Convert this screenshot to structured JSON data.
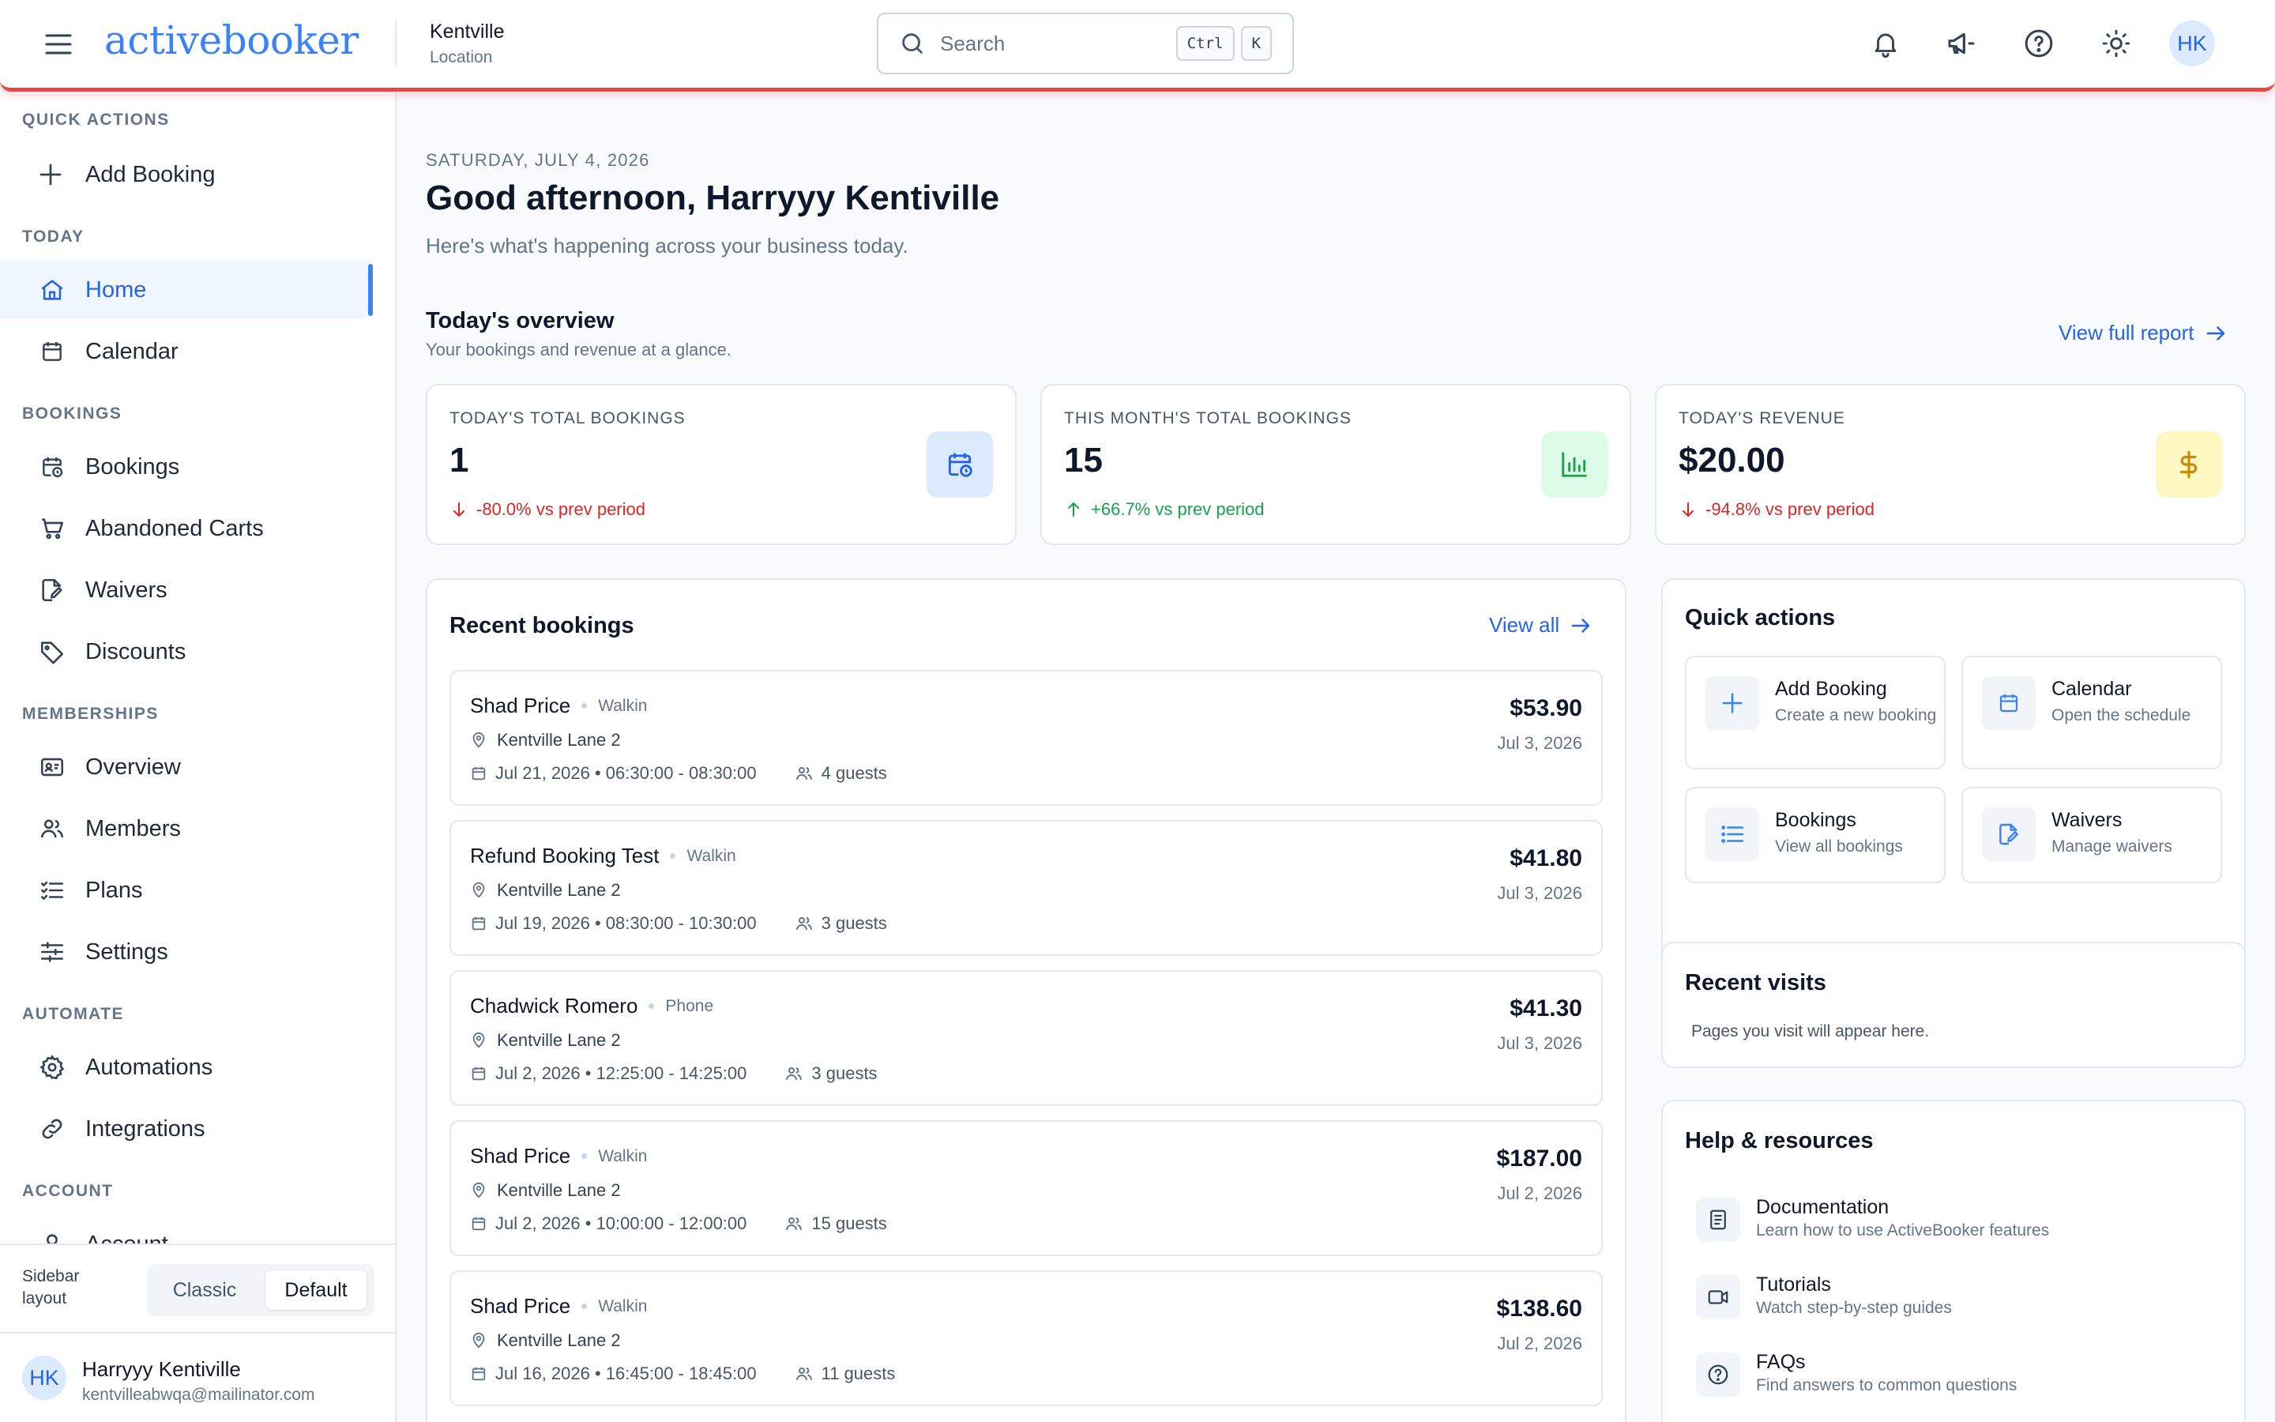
{
  "header": {
    "logo_text": "activebooker",
    "location_name": "Kentville",
    "location_label": "Location",
    "search_placeholder": "Search",
    "shortcut_ctrl": "Ctrl",
    "shortcut_k": "K",
    "avatar_initials": "HK"
  },
  "sidebar": {
    "sections": {
      "quick_actions": "QUICK ACTIONS",
      "today": "TODAY",
      "bookings": "BOOKINGS",
      "memberships": "MEMBERSHIPS",
      "automate": "AUTOMATE",
      "account": "ACCOUNT"
    },
    "items": {
      "add_booking": "Add Booking",
      "home": "Home",
      "calendar": "Calendar",
      "bookings": "Bookings",
      "abandoned_carts": "Abandoned Carts",
      "waivers": "Waivers",
      "discounts": "Discounts",
      "overview": "Overview",
      "members": "Members",
      "plans": "Plans",
      "settings": "Settings",
      "automations": "Automations",
      "integrations": "Integrations",
      "account": "Account"
    },
    "active_item": "Home",
    "layout_label": "Sidebar layout",
    "layout_options": [
      "Classic",
      "Default"
    ],
    "layout_selected": "Default",
    "user": {
      "initials": "HK",
      "name": "Harryyy Kentiville",
      "email": "kentvilleabwqa@mailinator.com"
    }
  },
  "main": {
    "date": "SATURDAY, JULY 4, 2026",
    "greeting": "Good afternoon, Harryyy Kentiville",
    "greeting_sub": "Here's what's happening across your business today.",
    "overview_title": "Today's overview",
    "overview_sub": "Your bookings and revenue at a glance.",
    "view_full_report": "View full report",
    "stats": [
      {
        "label": "TODAY'S TOTAL BOOKINGS",
        "value": "1",
        "change": "-80.0% vs prev period",
        "direction": "down",
        "icon": "calendar-clock-icon",
        "icon_bg": "#dbeafe",
        "icon_color": "#2563eb"
      },
      {
        "label": "THIS MONTH'S TOTAL BOOKINGS",
        "value": "15",
        "change": "+66.7% vs prev period",
        "direction": "up",
        "icon": "bar-chart-icon",
        "icon_bg": "#dcfce7",
        "icon_color": "#16a34a"
      },
      {
        "label": "TODAY'S REVENUE",
        "value": "$20.00",
        "change": "-94.8% vs prev period",
        "direction": "down",
        "icon": "dollar-icon",
        "icon_bg": "#fef9c3",
        "icon_color": "#ca8a04"
      }
    ],
    "recent_bookings": {
      "title": "Recent bookings",
      "view_all": "View all",
      "items": [
        {
          "name": "Shad Price",
          "source": "Walkin",
          "location": "Kentville Lane 2",
          "when": "Jul 21, 2026 • 06:30:00 - 08:30:00",
          "guests": "4 guests",
          "amount": "$53.90",
          "date": "Jul 3, 2026"
        },
        {
          "name": "Refund Booking Test",
          "source": "Walkin",
          "location": "Kentville Lane 2",
          "when": "Jul 19, 2026 • 08:30:00 - 10:30:00",
          "guests": "3 guests",
          "amount": "$41.80",
          "date": "Jul 3, 2026"
        },
        {
          "name": "Chadwick Romero",
          "source": "Phone",
          "location": "Kentville Lane 2",
          "when": "Jul 2, 2026 • 12:25:00 - 14:25:00",
          "guests": "3 guests",
          "amount": "$41.30",
          "date": "Jul 3, 2026"
        },
        {
          "name": "Shad Price",
          "source": "Walkin",
          "location": "Kentville Lane 2",
          "when": "Jul 2, 2026 • 10:00:00 - 12:00:00",
          "guests": "15 guests",
          "amount": "$187.00",
          "date": "Jul 2, 2026"
        },
        {
          "name": "Shad Price",
          "source": "Walkin",
          "location": "Kentville Lane 2",
          "when": "Jul 16, 2026 • 16:45:00 - 18:45:00",
          "guests": "11 guests",
          "amount": "$138.60",
          "date": "Jul 2, 2026"
        }
      ]
    },
    "quick_actions": {
      "title": "Quick actions",
      "items": [
        {
          "title": "Add Booking",
          "sub": "Create a new booking"
        },
        {
          "title": "Calendar",
          "sub": "Open the schedule"
        },
        {
          "title": "Bookings",
          "sub": "View all bookings"
        },
        {
          "title": "Waivers",
          "sub": "Manage waivers"
        }
      ]
    },
    "recent_visits": {
      "title": "Recent visits",
      "empty": "Pages you visit will appear here."
    },
    "help": {
      "title": "Help & resources",
      "items": [
        {
          "title": "Documentation",
          "sub": "Learn how to use ActiveBooker features"
        },
        {
          "title": "Tutorials",
          "sub": "Watch step-by-step guides"
        },
        {
          "title": "FAQs",
          "sub": "Find answers to common questions"
        }
      ]
    }
  }
}
